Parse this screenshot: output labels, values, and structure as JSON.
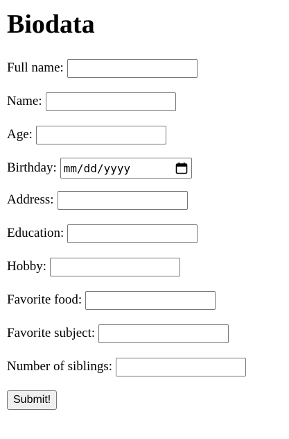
{
  "page": {
    "title": "Biodata"
  },
  "form": {
    "fields": [
      {
        "label": "Full name:",
        "value": ""
      },
      {
        "label": "Name:",
        "value": ""
      },
      {
        "label": "Age:",
        "value": ""
      },
      {
        "label": "Birthday:",
        "value": "mm/dd/yyyy"
      },
      {
        "label": "Address:",
        "value": ""
      },
      {
        "label": "Education:",
        "value": ""
      },
      {
        "label": "Hobby:",
        "value": ""
      },
      {
        "label": "Favorite food:",
        "value": ""
      },
      {
        "label": "Favorite subject:",
        "value": ""
      },
      {
        "label": "Number of siblings:",
        "value": ""
      }
    ],
    "submit_label": "Submit!",
    "icons": {
      "birthday_picker": "calendar-icon"
    }
  }
}
